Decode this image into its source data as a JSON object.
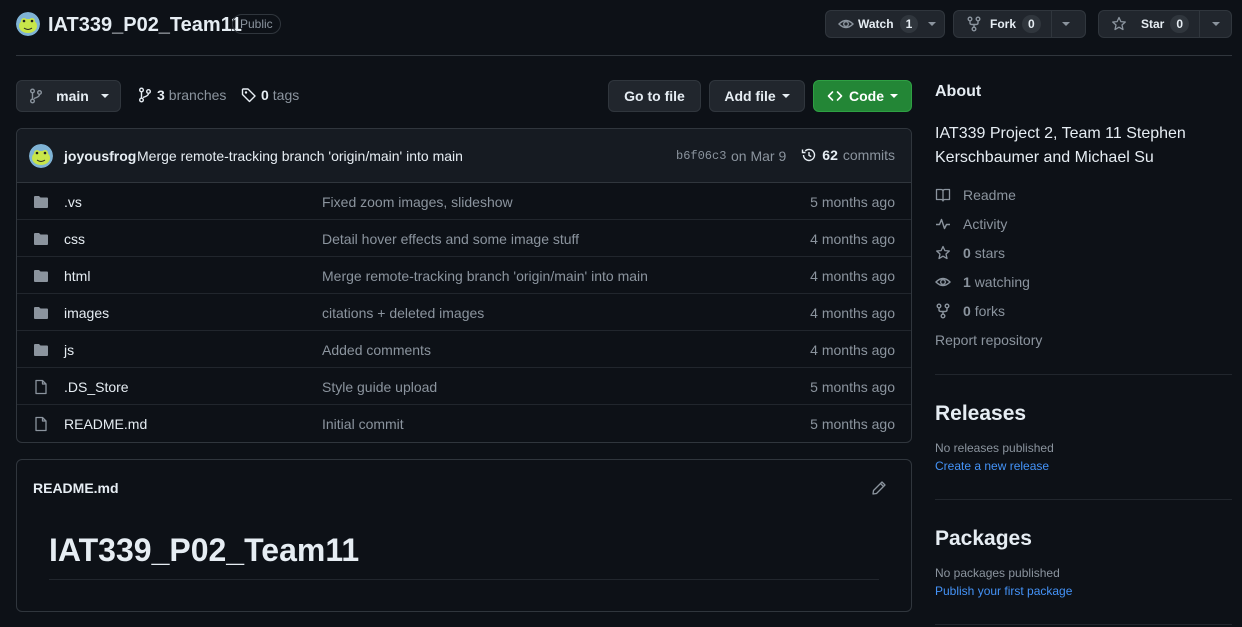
{
  "header": {
    "repo_name": "IAT339_P02_Team11",
    "visibility": "Public",
    "watch": {
      "label": "Watch",
      "count": "1"
    },
    "fork": {
      "label": "Fork",
      "count": "0"
    },
    "star": {
      "label": "Star",
      "count": "0"
    }
  },
  "nav": {
    "branch": "main",
    "branches_count": "3",
    "branches_label": "branches",
    "tags_count": "0",
    "tags_label": "tags",
    "go_to_file": "Go to file",
    "add_file": "Add file",
    "code": "Code"
  },
  "latest_commit": {
    "author": "joyousfrog",
    "message": "Merge remote-tracking branch 'origin/main' into main",
    "sha": "b6f06c3",
    "date": "on Mar 9",
    "commits_count": "62",
    "commits_label": "commits"
  },
  "files": [
    {
      "type": "folder",
      "name": ".vs",
      "message": "Fixed zoom images, slideshow",
      "age": "5 months ago"
    },
    {
      "type": "folder",
      "name": "css",
      "message": "Detail hover effects and some image stuff",
      "age": "4 months ago"
    },
    {
      "type": "folder",
      "name": "html",
      "message": "Merge remote-tracking branch 'origin/main' into main",
      "age": "4 months ago"
    },
    {
      "type": "folder",
      "name": "images",
      "message": "citations + deleted images",
      "age": "4 months ago"
    },
    {
      "type": "folder",
      "name": "js",
      "message": "Added comments",
      "age": "4 months ago"
    },
    {
      "type": "file",
      "name": ".DS_Store",
      "message": "Style guide upload",
      "age": "5 months ago"
    },
    {
      "type": "file",
      "name": "README.md",
      "message": "Initial commit",
      "age": "5 months ago"
    }
  ],
  "readme": {
    "filename": "README.md",
    "heading": "IAT339_P02_Team11"
  },
  "sidebar": {
    "about_title": "About",
    "about_description": "IAT339 Project 2, Team 11 Stephen Kerschbaumer and Michael Su",
    "readme_label": "Readme",
    "activity_label": "Activity",
    "stars_count": "0",
    "stars_label": "stars",
    "watching_count": "1",
    "watching_label": "watching",
    "forks_count": "0",
    "forks_label": "forks",
    "report_label": "Report repository",
    "releases_title": "Releases",
    "releases_empty": "No releases published",
    "releases_link": "Create a new release",
    "packages_title": "Packages",
    "packages_empty": "No packages published",
    "packages_link": "Publish your first package"
  },
  "colors": {
    "background": "#0d1117",
    "border": "#30363d",
    "muted_text": "#8b949e",
    "link": "#4493f8",
    "green_button": "#238636"
  }
}
